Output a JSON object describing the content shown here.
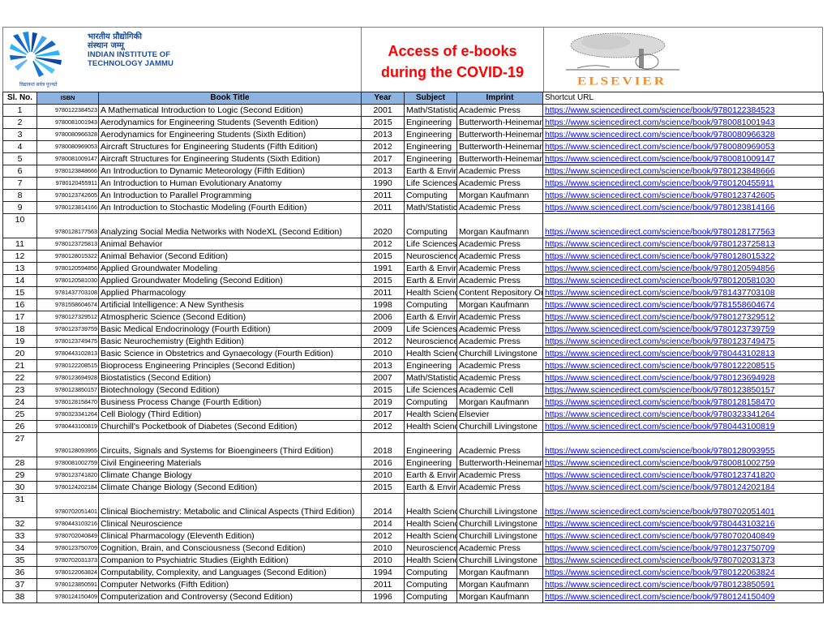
{
  "header": {
    "institute_hindi_line1": "भारतीय प्रौद्योगिकी",
    "institute_hindi_line2": "संस्थान जम्मू",
    "institute_en_line1": "INDIAN INSTITUTE OF",
    "institute_en_line2": "TECHNOLOGY JAMMU",
    "institute_motto": "विद्यावन्तं सर्वत्र पूज्यते",
    "title_line1": "Access of e-books",
    "title_line2": "during the COVID-19",
    "publisher_logo_text": "ELSEVIER",
    "title_color": "#ff0000",
    "header_fill_color": "#8db3e2",
    "link_color": "#0000ff"
  },
  "columns": {
    "slno": "Sl. No.",
    "isbn": "ISBN",
    "title": "Book Title",
    "year": "Year",
    "subject": "Subject",
    "imprint": "Imprint",
    "url": "Shortcut URL"
  },
  "rows": [
    {
      "slno": "1",
      "isbn": "9780122384523",
      "title": "A Mathematical Introduction to Logic (Second Edition)",
      "year": "2001",
      "subject": "Math/Statistics",
      "imprint": "Academic Press",
      "url": "https://www.sciencedirect.com/science/book/9780122384523"
    },
    {
      "slno": "2",
      "isbn": "9780081001943",
      "title": "Aerodynamics for Engineering Students (Seventh Edition)",
      "year": "2015",
      "subject": "Engineering",
      "imprint": "Butterworth-Heinemann",
      "url": "https://www.sciencedirect.com/science/book/9780081001943"
    },
    {
      "slno": "3",
      "isbn": "9780080966328",
      "title": "Aerodynamics for Engineering Students (Sixth Edition)",
      "year": "2013",
      "subject": "Engineering",
      "imprint": "Butterworth-Heinemann",
      "url": "https://www.sciencedirect.com/science/book/9780080966328"
    },
    {
      "slno": "4",
      "isbn": "9780080969053",
      "title": "Aircraft Structures for Engineering Students (Fifth Edition)",
      "year": "2012",
      "subject": "Engineering",
      "imprint": "Butterworth-Heinemann",
      "url": "https://www.sciencedirect.com/science/book/9780080969053"
    },
    {
      "slno": "5",
      "isbn": "9780081009147",
      "title": "Aircraft Structures for Engineering Students (Sixth Edition)",
      "year": "2017",
      "subject": "Engineering",
      "imprint": "Butterworth-Heinemann",
      "url": "https://www.sciencedirect.com/science/book/9780081009147"
    },
    {
      "slno": "6",
      "isbn": "9780123848666",
      "title": "An Introduction to Dynamic Meteorology (Fifth Edition)",
      "year": "2013",
      "subject": "Earth & Environmental",
      "imprint": "Academic Press",
      "url": "https://www.sciencedirect.com/science/book/9780123848666"
    },
    {
      "slno": "7",
      "isbn": "9780120455911",
      "title": "An Introduction to Human Evolutionary Anatomy",
      "year": "1990",
      "subject": "Life Sciences",
      "imprint": "Academic Press",
      "url": "https://www.sciencedirect.com/science/book/9780120455911"
    },
    {
      "slno": "8",
      "isbn": "9780123742605",
      "title": "An Introduction to Parallel Programming",
      "year": "2011",
      "subject": "Computing",
      "imprint": "Morgan Kaufmann",
      "url": "https://www.sciencedirect.com/science/book/9780123742605"
    },
    {
      "slno": "9",
      "isbn": "9780123814166",
      "title": "An Introduction to Stochastic Modeling (Fourth Edition)",
      "year": "2011",
      "subject": "Math/Statistics",
      "imprint": "Academic Press",
      "url": "https://www.sciencedirect.com/science/book/9780123814166"
    },
    {
      "slno": "10",
      "isbn": "9780128177563",
      "title": "Analyzing Social Media Networks with NodeXL (Second Edition)",
      "year": "2020",
      "subject": "Computing",
      "imprint": "Morgan Kaufmann",
      "url": "https://www.sciencedirect.com/science/book/9780128177563",
      "tall": true
    },
    {
      "slno": "11",
      "isbn": "9780123725813",
      "title": "Animal Behavior",
      "year": "2012",
      "subject": "Life Sciences",
      "imprint": "Academic Press",
      "url": "https://www.sciencedirect.com/science/book/9780123725813"
    },
    {
      "slno": "12",
      "isbn": "9780128015322",
      "title": "Animal Behavior (Second Edition)",
      "year": "2015",
      "subject": "Neuroscience",
      "imprint": "Academic Press",
      "url": "https://www.sciencedirect.com/science/book/9780128015322"
    },
    {
      "slno": "13",
      "isbn": "9780120594856",
      "title": "Applied Groundwater Modeling",
      "year": "1991",
      "subject": "Earth & Environmental",
      "imprint": "Academic Press",
      "url": "https://www.sciencedirect.com/science/book/9780120594856"
    },
    {
      "slno": "14",
      "isbn": "9780120581030",
      "title": "Applied Groundwater Modeling (Second Edition)",
      "year": "2015",
      "subject": "Earth & Environmental",
      "imprint": "Academic Press",
      "url": "https://www.sciencedirect.com/science/book/9780120581030"
    },
    {
      "slno": "15",
      "isbn": "9781437703108",
      "title": "Applied Pharmacology",
      "year": "2011",
      "subject": "Health Sciences",
      "imprint": "Content Repository Only",
      "url": "https://www.sciencedirect.com/science/book/9781437703108"
    },
    {
      "slno": "16",
      "isbn": "9781558604674",
      "title": "Artificial Intelligence: A New Synthesis",
      "year": "1998",
      "subject": "Computing",
      "imprint": "Morgan Kaufmann",
      "url": "https://www.sciencedirect.com/science/book/9781558604674"
    },
    {
      "slno": "17",
      "isbn": "9780127329512",
      "title": "Atmospheric Science (Second Edition)",
      "year": "2006",
      "subject": "Earth & Environmental",
      "imprint": "Academic Press",
      "url": "https://www.sciencedirect.com/science/book/9780127329512"
    },
    {
      "slno": "18",
      "isbn": "9780123739759",
      "title": "Basic Medical Endocrinology (Fourth Edition)",
      "year": "2009",
      "subject": "Life Sciences",
      "imprint": "Academic Press",
      "url": "https://www.sciencedirect.com/science/book/9780123739759"
    },
    {
      "slno": "19",
      "isbn": "9780123749475",
      "title": "Basic Neurochemistry (Eighth Edition)",
      "year": "2012",
      "subject": "Neuroscience",
      "imprint": "Academic Press",
      "url": "https://www.sciencedirect.com/science/book/9780123749475"
    },
    {
      "slno": "20",
      "isbn": "9780443102813",
      "title": "Basic Science in Obstetrics and Gynaecology (Fourth Edition)",
      "year": "2010",
      "subject": "Health Sciences",
      "imprint": "Churchill Livingstone",
      "url": "https://www.sciencedirect.com/science/book/9780443102813"
    },
    {
      "slno": "21",
      "isbn": "9780122208515",
      "title": "Bioprocess Engineering Principles (Second Edition)",
      "year": "2013",
      "subject": "Engineering",
      "imprint": "Academic Press",
      "url": "https://www.sciencedirect.com/science/book/9780122208515"
    },
    {
      "slno": "22",
      "isbn": "9780123694928",
      "title": "Biostatistics (Second Edition)",
      "year": "2007",
      "subject": "Math/Statistics",
      "imprint": "Academic Press",
      "url": "https://www.sciencedirect.com/science/book/9780123694928"
    },
    {
      "slno": "23",
      "isbn": "9780123850157",
      "title": "Biotechnology (Second Edition)",
      "year": "2015",
      "subject": "Life Sciences",
      "imprint": "Academic Cell",
      "url": "https://www.sciencedirect.com/science/book/9780123850157"
    },
    {
      "slno": "24",
      "isbn": "9780128158470",
      "title": "Business Process Change (Fourth Edition)",
      "year": "2019",
      "subject": "Computing",
      "imprint": "Morgan Kaufmann",
      "url": "https://www.sciencedirect.com/science/book/9780128158470"
    },
    {
      "slno": "25",
      "isbn": "9780323341264",
      "title": "Cell Biology (Third Edition)",
      "year": "2017",
      "subject": "Health Sciences",
      "imprint": "Elsevier",
      "url": "https://www.sciencedirect.com/science/book/9780323341264"
    },
    {
      "slno": "26",
      "isbn": "9780443100819",
      "title": "Churchill's Pocketbook of Diabetes (Second Edition)",
      "year": "2012",
      "subject": "Health Sciences",
      "imprint": "Churchill Livingstone",
      "url": "https://www.sciencedirect.com/science/book/9780443100819"
    },
    {
      "slno": "27",
      "isbn": "9780128093955",
      "title": "Circuits, Signals and Systems for Bioengineers (Third Edition)",
      "year": "2018",
      "subject": "Engineering",
      "imprint": "Academic Press",
      "url": "https://www.sciencedirect.com/science/book/9780128093955",
      "tall": true
    },
    {
      "slno": "28",
      "isbn": "9780081002759",
      "title": "Civil Engineering Materials",
      "year": "2016",
      "subject": "Engineering",
      "imprint": "Butterworth-Heinemann",
      "url": "https://www.sciencedirect.com/science/book/9780081002759"
    },
    {
      "slno": "29",
      "isbn": "9780123741820",
      "title": "Climate Change Biology",
      "year": "2010",
      "subject": "Earth & Environmental",
      "imprint": "Academic Press",
      "url": "https://www.sciencedirect.com/science/book/9780123741820"
    },
    {
      "slno": "30",
      "isbn": "9780124202184",
      "title": "Climate Change Biology (Second Edition)",
      "year": "2015",
      "subject": "Earth & Environmental",
      "imprint": "Academic Press",
      "url": "https://www.sciencedirect.com/science/book/9780124202184"
    },
    {
      "slno": "31",
      "isbn": "9780702051401",
      "title": "Clinical Biochemistry: Metabolic and Clinical Aspects (Third Edition)",
      "year": "2014",
      "subject": "Health Sciences",
      "imprint": "Churchill Livingstone",
      "url": "https://www.sciencedirect.com/science/book/9780702051401",
      "tall": true,
      "wrap": true
    },
    {
      "slno": "32",
      "isbn": "9780443103216",
      "title": "Clinical Neuroscience",
      "year": "2014",
      "subject": "Health Sciences",
      "imprint": "Churchill Livingstone",
      "url": "https://www.sciencedirect.com/science/book/9780443103216"
    },
    {
      "slno": "33",
      "isbn": "9780702040849",
      "title": "Clinical Pharmacology (Eleventh Edition)",
      "year": "2012",
      "subject": "Health Sciences",
      "imprint": "Churchill Livingstone",
      "url": "https://www.sciencedirect.com/science/book/9780702040849"
    },
    {
      "slno": "34",
      "isbn": "9780123750709",
      "title": "Cognition, Brain, and Consciousness (Second Edition)",
      "year": "2010",
      "subject": "Neuroscience",
      "imprint": "Academic Press",
      "url": "https://www.sciencedirect.com/science/book/9780123750709"
    },
    {
      "slno": "35",
      "isbn": "9780702031373",
      "title": "Companion to Psychiatric Studies (Eighth Edition)",
      "year": "2010",
      "subject": "Health Sciences",
      "imprint": "Churchill Livingstone",
      "url": "https://www.sciencedirect.com/science/book/9780702031373"
    },
    {
      "slno": "36",
      "isbn": "9780122063824",
      "title": "Computability, Complexity, and Languages (Second Edition)",
      "year": "1994",
      "subject": "Computing",
      "imprint": "Morgan Kaufmann",
      "url": "https://www.sciencedirect.com/science/book/9780122063824"
    },
    {
      "slno": "37",
      "isbn": "9780123850591",
      "title": "Computer Networks (Fifth Edition)",
      "year": "2011",
      "subject": "Computing",
      "imprint": "Morgan Kaufmann",
      "url": "https://www.sciencedirect.com/science/book/9780123850591"
    },
    {
      "slno": "38",
      "isbn": "9780124150409",
      "title": "Computerization and Controversy (Second Edition)",
      "year": "1996",
      "subject": "Computing",
      "imprint": "Morgan Kaufmann",
      "url": "https://www.sciencedirect.com/science/book/9780124150409"
    }
  ]
}
